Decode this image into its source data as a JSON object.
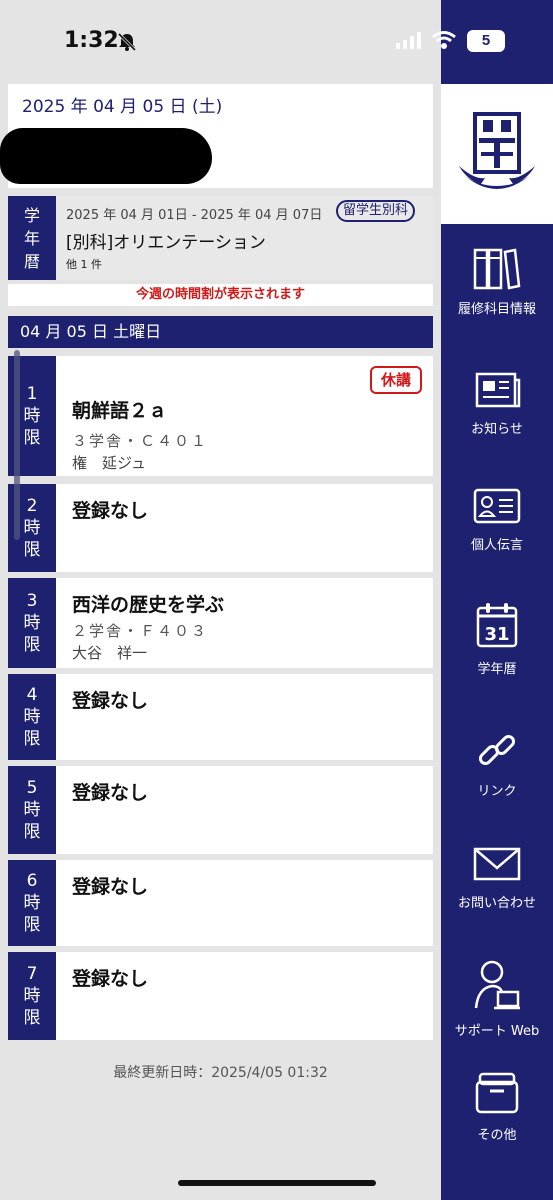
{
  "status": {
    "time": "1:32",
    "battery": "5"
  },
  "header": {
    "date": "2025 年 04 月 05 日 (土)"
  },
  "calendar": {
    "side_chars": [
      "学",
      "年",
      "暦"
    ],
    "range": "2025 年 04 月 01日 - 2025 年 04 月 07日",
    "badge": "留学生別科",
    "title": "[別科]オリエンテーション",
    "more": "他 1 件"
  },
  "notice": "今週の時間割が表示されます",
  "day_bar": "04 月 05 日  土曜日",
  "periods": [
    {
      "num": "1",
      "course": "朝鮮語２ａ",
      "room": "３学舎・Ｃ４０１",
      "teacher": "権　延ジュ",
      "cancel": "休講"
    },
    {
      "num": "2",
      "course": "登録なし"
    },
    {
      "num": "3",
      "course": "西洋の歴史を学ぶ",
      "room": "２学舎・Ｆ４０３",
      "teacher": "大谷　祥一"
    },
    {
      "num": "4",
      "course": "登録なし"
    },
    {
      "num": "5",
      "course": "登録なし"
    },
    {
      "num": "6",
      "course": "登録なし"
    },
    {
      "num": "7",
      "course": "登録なし"
    }
  ],
  "period_chars": {
    "ji": "時",
    "gen": "限"
  },
  "updated": "最終更新日時：2025/4/05 01:32",
  "nav": [
    {
      "label": "履修科目情報",
      "icon": "books-icon"
    },
    {
      "label": "お知らせ",
      "icon": "news-icon"
    },
    {
      "label": "個人伝言",
      "icon": "id-card-icon"
    },
    {
      "label": "学年暦",
      "icon": "calendar-icon",
      "icon_text": "31"
    },
    {
      "label": "リンク",
      "icon": "link-icon"
    },
    {
      "label": "お問い合わせ",
      "icon": "mail-icon"
    },
    {
      "label": "サポート Web",
      "icon": "support-icon"
    },
    {
      "label": "その他",
      "icon": "box-icon"
    }
  ],
  "colors": {
    "navy": "#1e2170",
    "red": "#d01a1a",
    "bg": "#e4e4e4"
  }
}
